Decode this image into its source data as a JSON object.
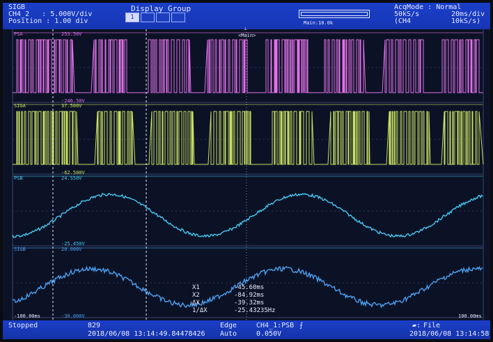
{
  "header": {
    "ch_name": "SIGB",
    "ch_line": "CH4_2   : 5.000V/div",
    "pos_line": "Position : 1.00 div",
    "display_group_title": "Display Group",
    "display_group_active": "1",
    "zoom_label": "Main:10.0k",
    "acq_mode": "AcqMode : Normal",
    "rate": "50kS/s",
    "time_div": "20ms/div",
    "ch_ref": "(CH4",
    "ch_rate": "10kS/s)"
  },
  "markers": {
    "trigger_label": "<Main>",
    "psa_name": "PSA",
    "psa_top": "253.50V",
    "psa_bottom": "-246.50V",
    "siga_name": "SIGA",
    "siga_top": "37.500V",
    "siga_bottom": "-62.500V",
    "psb_name": "PSB",
    "psb_top": "24.550V",
    "psb_bottom": "-25.450V",
    "sigb_name": "SIGB",
    "sigb_top": "20.000V",
    "sigb_bottom": "-30.000V",
    "time_left": "-100.00ms",
    "time_right": "100.00ms"
  },
  "cursors": {
    "rows": [
      {
        "key": "X1",
        "val": "-45.60ms"
      },
      {
        "key": "X2",
        "val": "-84.92ms"
      },
      {
        "key": "ΔX",
        "val": "-39.32ms"
      },
      {
        "key": "1/ΔX",
        "val": "-25.43235Hz"
      }
    ]
  },
  "footer": {
    "status": "Stopped",
    "count": "829",
    "trigger_time": "2018/06/08 13:14:49.84478426",
    "trig_type": "Edge",
    "trig_mode": "Auto",
    "trig_src": "CH4_1:PSB",
    "trig_level": "0.050V",
    "file_label": "File",
    "clock": "2018/06/08 13:14:58"
  },
  "colors": {
    "psa": "#e070e8",
    "siga": "#c8e060",
    "psb": "#44c8f0",
    "sigb": "#4aa0f0",
    "bar": "#1636b4"
  }
}
